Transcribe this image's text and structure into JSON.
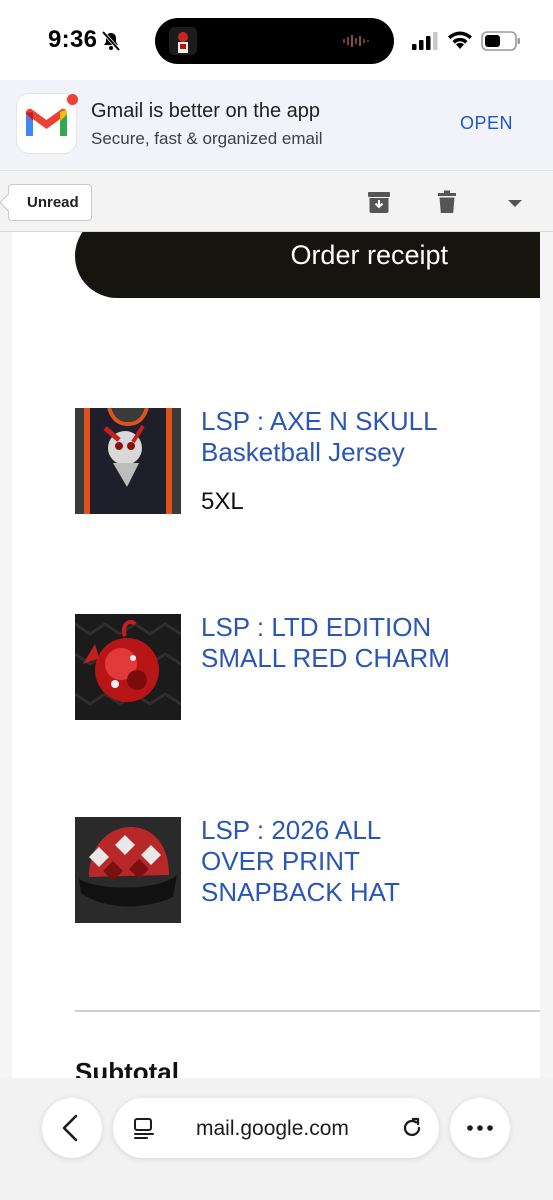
{
  "status_bar": {
    "time": "9:36"
  },
  "app_banner": {
    "title": "Gmail is better on the app",
    "subtitle": "Secure, fast & organized email",
    "open_label": "OPEN"
  },
  "toolbar": {
    "unread_label": "Unread"
  },
  "email": {
    "header_title": "Order receipt",
    "items": [
      {
        "name_line1": "LSP : AXE N SKULL",
        "name_line2": "Basketball Jersey",
        "variant": "5XL"
      },
      {
        "name_line1": "LSP : LTD EDITION",
        "name_line2": "SMALL RED CHARM"
      },
      {
        "name_line1": "LSP : 2026 ALL",
        "name_line2": "OVER PRINT",
        "name_line3": "SNAPBACK HAT"
      }
    ],
    "subtotal_label": "Subtotal"
  },
  "browser": {
    "url": "mail.google.com"
  },
  "colors": {
    "link": "#2a56b5",
    "open_button": "#1a57c9",
    "receipt_header_bg": "#16140f"
  }
}
